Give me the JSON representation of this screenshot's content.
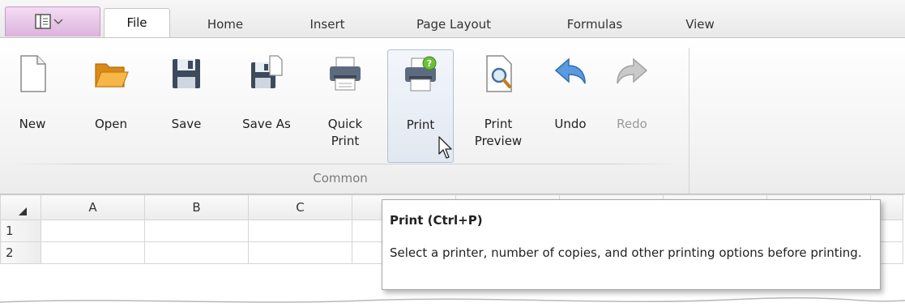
{
  "tabs": [
    {
      "label": "File",
      "active": true
    },
    {
      "label": "Home",
      "active": false
    },
    {
      "label": "Insert",
      "active": false
    },
    {
      "label": "Page Layout",
      "active": false
    },
    {
      "label": "Formulas",
      "active": false
    },
    {
      "label": "View",
      "active": false
    }
  ],
  "ribbon": {
    "group_label": "Common",
    "buttons": [
      {
        "label": "New",
        "icon": "new-document-icon",
        "enabled": true
      },
      {
        "label": "Open",
        "icon": "open-folder-icon",
        "enabled": true
      },
      {
        "label": "Save",
        "icon": "save-icon",
        "enabled": true
      },
      {
        "label": "Save As",
        "icon": "save-as-icon",
        "enabled": true
      },
      {
        "label": "Quick Print",
        "icon": "quick-print-icon",
        "enabled": true
      },
      {
        "label": "Print",
        "icon": "print-icon",
        "enabled": true,
        "hovered": true
      },
      {
        "label": "Print Preview",
        "icon": "print-preview-icon",
        "enabled": true
      },
      {
        "label": "Undo",
        "icon": "undo-icon",
        "enabled": true
      },
      {
        "label": "Redo",
        "icon": "redo-icon",
        "enabled": false
      }
    ]
  },
  "sheet": {
    "columns": [
      "A",
      "B",
      "C"
    ],
    "rows": [
      "1",
      "2"
    ]
  },
  "tooltip": {
    "title": "Print (Ctrl+P)",
    "body": "Select a printer, number of copies, and other printing options before printing."
  },
  "colors": {
    "app_button": "#dcb3dc",
    "hover_bg": "#e2e8f1",
    "undo_blue": "#4a8fd4",
    "folder_orange": "#f2a93b"
  }
}
